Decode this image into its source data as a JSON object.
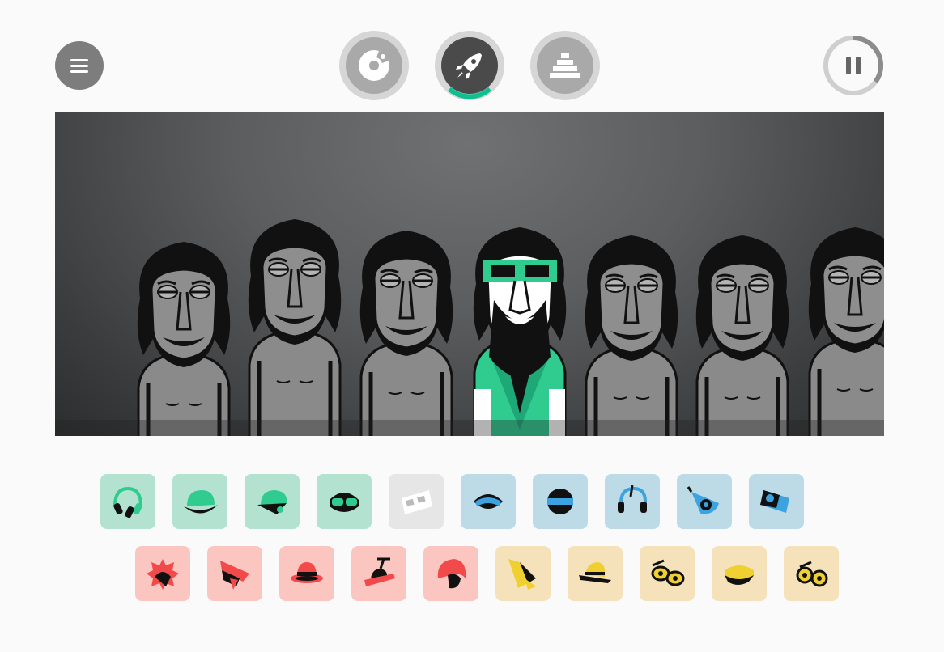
{
  "menu": {
    "icon": "hamburger-icon"
  },
  "modes": [
    {
      "icon": "vinyl-disc-icon",
      "active": false
    },
    {
      "icon": "rocket-icon",
      "active": true
    },
    {
      "icon": "temple-icon",
      "active": false
    }
  ],
  "playback": {
    "icon": "pause-icon",
    "progress": 0.35
  },
  "colors": {
    "background": "#fafafa",
    "green_slot": "#b3e3d0",
    "green_icon": "#2fcb8f",
    "blue_slot": "#bcdbe6",
    "blue_icon": "#3da3e0",
    "red_slot": "#fcc6c0",
    "red_icon": "#f24a4a",
    "yellow_slot": "#f5e2bb",
    "yellow_icon": "#f0d030",
    "grey_slot": "#e6e6e6",
    "progress_ring": "#0fbf8f"
  },
  "characters": [
    {
      "state": "idle"
    },
    {
      "state": "idle"
    },
    {
      "state": "idle"
    },
    {
      "state": "active",
      "accessory": "green-goggles",
      "color": "#2fcb8f"
    },
    {
      "state": "idle"
    },
    {
      "state": "idle"
    },
    {
      "state": "idle"
    }
  ],
  "sound_rows": [
    [
      {
        "icon": "headphones-icon",
        "group": "green",
        "state": "available"
      },
      {
        "icon": "cap-icon",
        "group": "green",
        "state": "available"
      },
      {
        "icon": "cap-visor-icon",
        "group": "green",
        "state": "available"
      },
      {
        "icon": "goggles-icon",
        "group": "green",
        "state": "available"
      },
      {
        "icon": "3d-glasses-icon",
        "group": "grey",
        "state": "used"
      },
      {
        "icon": "visor-icon",
        "group": "blue",
        "state": "available"
      },
      {
        "icon": "mask-icon",
        "group": "blue",
        "state": "available"
      },
      {
        "icon": "headset-icon",
        "group": "blue",
        "state": "available"
      },
      {
        "icon": "eye-patch-icon",
        "group": "blue",
        "state": "available"
      },
      {
        "icon": "camera-icon",
        "group": "blue",
        "state": "available"
      }
    ],
    [
      {
        "icon": "spiky-hair-icon",
        "group": "red",
        "state": "available"
      },
      {
        "icon": "bandana-icon",
        "group": "red",
        "state": "available"
      },
      {
        "icon": "fedora-icon",
        "group": "red",
        "state": "available"
      },
      {
        "icon": "propeller-hat-icon",
        "group": "red",
        "state": "available"
      },
      {
        "icon": "hood-icon",
        "group": "red",
        "state": "available"
      },
      {
        "icon": "scarf-icon",
        "group": "yellow",
        "state": "available"
      },
      {
        "icon": "straw-hat-icon",
        "group": "yellow",
        "state": "available"
      },
      {
        "icon": "sunglasses-icon",
        "group": "yellow",
        "state": "available"
      },
      {
        "icon": "beret-icon",
        "group": "yellow",
        "state": "available"
      },
      {
        "icon": "round-glasses-icon",
        "group": "yellow",
        "state": "available"
      }
    ]
  ]
}
